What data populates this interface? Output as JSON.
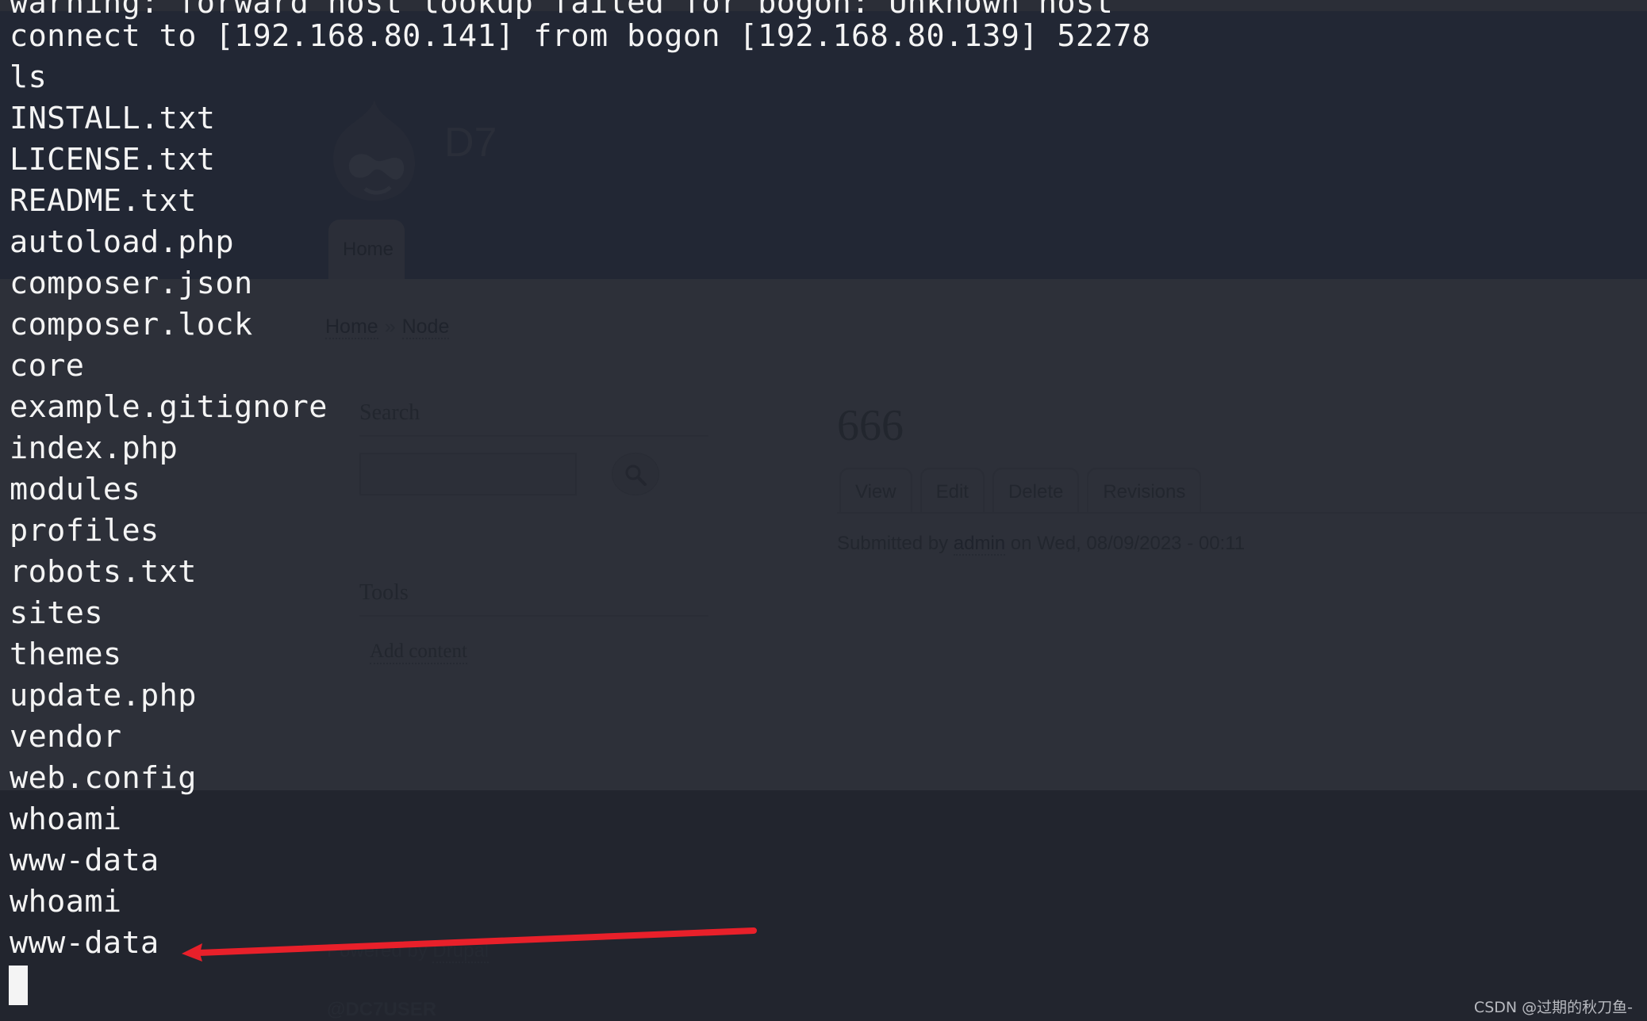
{
  "terminal": {
    "lines": [
      "warning: forward host lookup failed for bogon: Unknown host",
      "connect to [192.168.80.141] from bogon [192.168.80.139] 52278",
      "ls",
      "INSTALL.txt",
      "LICENSE.txt",
      "README.txt",
      "autoload.php",
      "composer.json",
      "composer.lock",
      "core",
      "example.gitignore",
      "index.php",
      "modules",
      "profiles",
      "robots.txt",
      "sites",
      "themes",
      "update.php",
      "vendor",
      "web.config",
      "whoami",
      "www-data",
      "whoami",
      "www-data"
    ],
    "highlighted_line_index": 23
  },
  "background_page": {
    "site_name": "D7",
    "nav": {
      "home_tab": "Home"
    },
    "breadcrumb": {
      "items": [
        "Home",
        "Node"
      ],
      "separator": "»"
    },
    "sidebar": {
      "search_title": "Search",
      "search_placeholder": "",
      "search_icon": "search-icon",
      "tools_title": "Tools",
      "tools_link": "Add content"
    },
    "node": {
      "title": "666",
      "tabs": [
        "View",
        "Edit",
        "Delete",
        "Revisions"
      ],
      "submitted_prefix": "Submitted by",
      "author": "admin",
      "submitted_suffix": "on Wed, 08/09/2023 - 00:11"
    },
    "footer": {
      "powered_prefix": "Powered by",
      "powered_link": "Drupal",
      "user": "@DC7USER"
    }
  },
  "annotation": {
    "arrow_color": "#e8202a"
  },
  "watermark": "CSDN @过期的秋刀鱼-"
}
